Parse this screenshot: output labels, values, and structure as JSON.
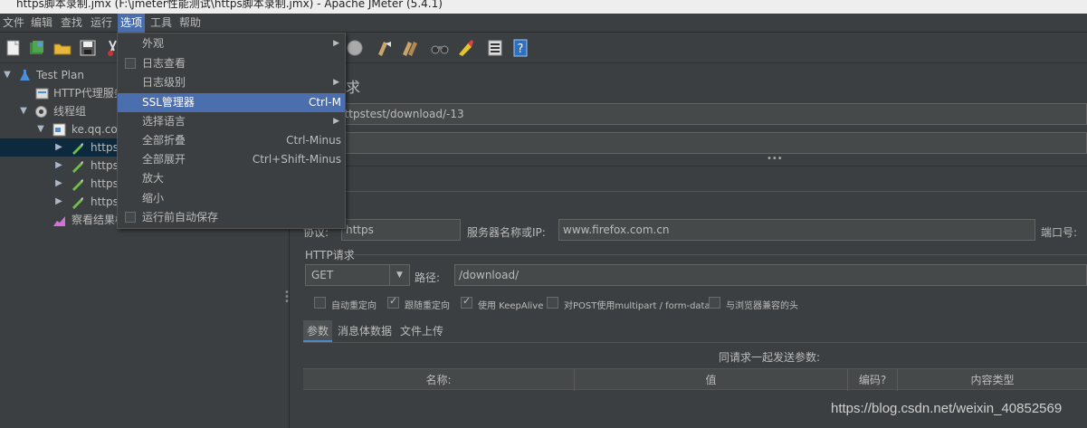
{
  "window": {
    "title": "https脚本录制.jmx (F:\\jmeter性能测试\\https脚本录制.jmx) - Apache JMeter (5.4.1)"
  },
  "menubar": {
    "items": [
      "文件",
      "编辑",
      "查找",
      "运行",
      "选项",
      "工具",
      "帮助"
    ],
    "active": "选项"
  },
  "options_menu": {
    "items": [
      {
        "label": "外观",
        "shortcut": "",
        "submenu": true,
        "checkbox": false
      },
      {
        "label": "日志查看",
        "shortcut": "",
        "submenu": false,
        "checkbox": true
      },
      {
        "label": "日志级别",
        "shortcut": "",
        "submenu": true,
        "checkbox": false
      },
      {
        "label": "SSL管理器",
        "shortcut": "Ctrl-M",
        "submenu": false,
        "checkbox": false,
        "highlighted": true
      },
      {
        "label": "选择语言",
        "shortcut": "",
        "submenu": true,
        "checkbox": false
      },
      {
        "label": "全部折叠",
        "shortcut": "Ctrl-Minus",
        "submenu": false,
        "checkbox": false
      },
      {
        "label": "全部展开",
        "shortcut": "Ctrl+Shift-Minus",
        "submenu": false,
        "checkbox": false
      },
      {
        "label": "放大",
        "shortcut": "",
        "submenu": false,
        "checkbox": false
      },
      {
        "label": "缩小",
        "shortcut": "",
        "submenu": false,
        "checkbox": false
      },
      {
        "label": "运行前自动保存",
        "shortcut": "",
        "submenu": false,
        "checkbox": true
      }
    ]
  },
  "tree": {
    "test_plan": "Test Plan",
    "proxy": "HTTP代理服务器",
    "thread_group": "线程组",
    "controller": "ke.qq.com",
    "samplers": [
      "https",
      "https",
      "https",
      "https"
    ],
    "listener": "察看结果树"
  },
  "sampler": {
    "title": "求",
    "name_value": "httpstest/download/-13",
    "comment_value": "",
    "web_server_section": "器",
    "protocol_label": "协议:",
    "protocol_value": "https",
    "server_label": "服务器名称或IP:",
    "server_value": "www.firefox.com.cn",
    "port_label": "端口号:",
    "http_request_section": "HTTP请求",
    "method": "GET",
    "path_label": "路径:",
    "path_value": "/download/",
    "checkboxes": [
      {
        "label": "自动重定向",
        "checked": false
      },
      {
        "label": "跟随重定向",
        "checked": true
      },
      {
        "label": "使用 KeepAlive",
        "checked": true
      },
      {
        "label": "对POST使用multipart / form-data",
        "checked": false
      },
      {
        "label": "与浏览器兼容的头",
        "checked": false
      }
    ],
    "tabs": [
      "参数",
      "消息体数据",
      "文件上传"
    ],
    "active_tab": "参数",
    "params_caption": "同请求一起发送参数:",
    "columns": [
      "名称:",
      "值",
      "编码?",
      "内容类型"
    ]
  },
  "watermark": "https://blog.csdn.net/weixin_40852569",
  "colors": {
    "highlight": "#4b6eaf",
    "background": "#3c3f41",
    "selection": "#0d293e"
  }
}
